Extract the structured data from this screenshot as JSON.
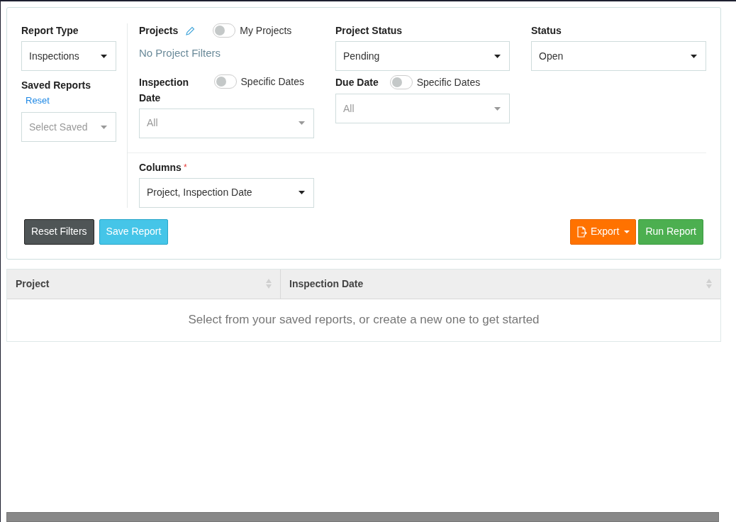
{
  "filters": {
    "report_type": {
      "label": "Report Type",
      "value": "Inspections"
    },
    "saved_reports": {
      "label": "Saved Reports",
      "reset_link": "Reset",
      "placeholder": "Select Saved"
    },
    "projects": {
      "label": "Projects",
      "toggle": {
        "label": "My Projects",
        "on": false
      },
      "empty_text": "No Project Filters"
    },
    "inspection_date": {
      "label": "Inspection Date",
      "toggle": {
        "label": "Specific Dates",
        "on": false
      },
      "placeholder": "All"
    },
    "project_status": {
      "label": "Project Status",
      "value": "Pending"
    },
    "due_date": {
      "label": "Due Date",
      "toggle": {
        "label": "Specific Dates",
        "on": false
      },
      "placeholder": "All"
    },
    "status": {
      "label": "Status",
      "value": "Open"
    },
    "columns": {
      "label": "Columns",
      "required_mark": "*",
      "value": "Project, Inspection Date"
    }
  },
  "buttons": {
    "reset_filters": "Reset Filters",
    "save_report": "Save Report",
    "export": "Export",
    "run_report": "Run Report"
  },
  "table": {
    "columns": [
      "Project",
      "Inspection Date"
    ],
    "empty_message": "Select from your saved reports, or create a new one to get started"
  }
}
